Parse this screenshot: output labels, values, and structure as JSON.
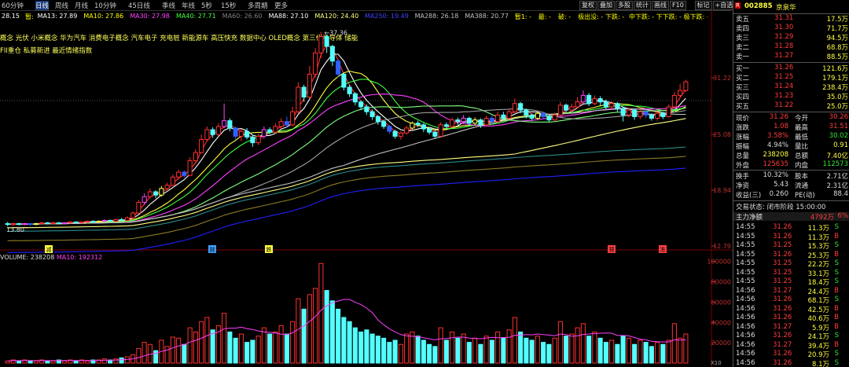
{
  "toolbar": {
    "periods": [
      "60分钟",
      "日线",
      "周线",
      "月线",
      "10分钟",
      "45日线",
      "季线",
      "年线",
      "5秒",
      "15秒",
      "多周期",
      "更多"
    ],
    "active": "日线",
    "right_buttons": [
      "复权",
      "叠加",
      "多股",
      "统计",
      "画线",
      "F10",
      "标记",
      "+自选",
      "返回"
    ]
  },
  "ma_legend": [
    {
      "text": "28.15",
      "color": "#ffffff"
    },
    {
      "text": "暂:",
      "color": "#ffff00"
    },
    {
      "text": "MA13: 27.89",
      "color": "#ffffff"
    },
    {
      "text": "MA10: 27.86",
      "color": "#ffff00"
    },
    {
      "text": "MA30: 27.98",
      "color": "#ff40ff"
    },
    {
      "text": "MA40: 27.71",
      "color": "#40ff40"
    },
    {
      "text": "MA60: 26.60",
      "color": "#808080"
    },
    {
      "text": "MA88: 27.10",
      "color": "#ffffff"
    },
    {
      "text": "MA120: 24.40",
      "color": "#ffff80"
    },
    {
      "text": "MA250: 19.49",
      "color": "#4040ff"
    },
    {
      "text": "MA288: 26.18",
      "color": "#c0c0c0"
    },
    {
      "text": "MA388: 20.77",
      "color": "#c0c0c0"
    },
    {
      "text": "暂1: -",
      "color": "#ffff00"
    },
    {
      "text": "最: -",
      "color": "#ffff00"
    },
    {
      "text": "破: -",
      "color": "#ffff00"
    },
    {
      "text": "极出没: -",
      "color": "#ffff00"
    },
    {
      "text": "下跌: -",
      "color": "#ffff00"
    },
    {
      "text": "中下跌: -",
      "color": "#ffff00"
    },
    {
      "text": "下下跌: -",
      "color": "#ffff00"
    },
    {
      "text": "极下跌: -",
      "color": "#ffff00"
    },
    {
      "text": "小冷窗: -",
      "color": "#ffff00"
    },
    {
      "text": "最高价跌幅%: 0.88",
      "color": "#40ff40"
    },
    {
      "text": "最低价120涨%: 0.8",
      "color": "#ff4040"
    }
  ],
  "concepts_line1": "概念 光伏 小米概念 华为汽车 消费电子概念 汽车电子 充电桩 新能源车 高压快充 数据中心 OLED概念 第三代半导体 储能",
  "concepts_line2": "FII重仓 私募新进 最近情绪指数",
  "price_axis": [
    "31.22",
    "25.08",
    "18.94",
    "12.79"
  ],
  "vol_axis": [
    "100000",
    "80000",
    "60000",
    "40000",
    "20000"
  ],
  "volume_label": {
    "vol": "VOLUME: 238208",
    "ma5": "MA10: 192312",
    "ma10": "MA10: 192312"
  },
  "peak_label": "37.36",
  "low_label": "13.80",
  "events": [
    {
      "t": "减",
      "c": "#ffff40"
    },
    {
      "t": "财",
      "c": "#40a0ff"
    },
    {
      "t": "跌",
      "c": "#ffff40"
    },
    {
      "t": "预",
      "c": "#ff4040"
    },
    {
      "t": "冻",
      "c": "#ff4040"
    }
  ],
  "x10": "X10",
  "quote": {
    "code": "002885",
    "name": "京泉华",
    "asks": [
      {
        "l": "卖五",
        "p": "31.31",
        "v": "17.5万"
      },
      {
        "l": "卖四",
        "p": "31.30",
        "v": "71.7万"
      },
      {
        "l": "卖三",
        "p": "31.29",
        "v": "94.5万"
      },
      {
        "l": "卖二",
        "p": "31.28",
        "v": "68.8万"
      },
      {
        "l": "卖一",
        "p": "31.27",
        "v": "88.5万"
      }
    ],
    "bids": [
      {
        "l": "买一",
        "p": "31.26",
        "v": "121.6万"
      },
      {
        "l": "买二",
        "p": "31.25",
        "v": "179.1万"
      },
      {
        "l": "买三",
        "p": "31.24",
        "v": "238.4万"
      },
      {
        "l": "买四",
        "p": "31.23",
        "v": "35.0万"
      },
      {
        "l": "买五",
        "p": "31.22",
        "v": "25.0万"
      }
    ],
    "stats": [
      {
        "a": "现价",
        "av": "31.26",
        "b": "今开",
        "bv": "30.26"
      },
      {
        "a": "涨跌",
        "av": "1.08",
        "b": "最高",
        "bv": "31.51"
      },
      {
        "a": "涨幅",
        "av": "3.58%",
        "b": "最低",
        "bv": "30.02"
      },
      {
        "a": "振幅",
        "av": "4.94%",
        "b": "量比",
        "bv": "0.91"
      },
      {
        "a": "总量",
        "av": "238208",
        "b": "总额",
        "bv": "7.40亿"
      },
      {
        "a": "外盘",
        "av": "125635",
        "b": "内盘",
        "bv": "112573"
      },
      {
        "a": "换手",
        "av": "10.32%",
        "b": "股本",
        "bv": "2.71亿"
      },
      {
        "a": "净资",
        "av": "5.43",
        "b": "流通",
        "bv": "2.31亿"
      },
      {
        "a": "收益(三)",
        "av": "0.260",
        "b": "PE(动)",
        "bv": "88.4"
      }
    ],
    "status": "交易状态: 闭市阶段 15:00:00",
    "net_inflow_label": "主力净额",
    "net_inflow": "4792万",
    "net_inflow_pct": "6%",
    "ticks": [
      {
        "t": "14:55",
        "p": "31.26",
        "v": "11.3万",
        "s": "S"
      },
      {
        "t": "14:55",
        "p": "31.26",
        "v": "11.3万",
        "s": "B"
      },
      {
        "t": "14:55",
        "p": "31.25",
        "v": "15.3万",
        "s": "S"
      },
      {
        "t": "14:55",
        "p": "31.26",
        "v": "25.3万",
        "s": "B"
      },
      {
        "t": "14:55",
        "p": "31.25",
        "v": "22.2万",
        "s": "S"
      },
      {
        "t": "14:55",
        "p": "31.25",
        "v": "33.1万",
        "s": "S"
      },
      {
        "t": "14:55",
        "p": "31.25",
        "v": "18.4万",
        "s": "S"
      },
      {
        "t": "14:56",
        "p": "31.27",
        "v": "24.4万",
        "s": "B"
      },
      {
        "t": "14:56",
        "p": "31.26",
        "v": "68.1万",
        "s": "S"
      },
      {
        "t": "14:56",
        "p": "31.26",
        "v": "42.5万",
        "s": "B"
      },
      {
        "t": "14:56",
        "p": "31.26",
        "v": "40.6万",
        "s": "B"
      },
      {
        "t": "14:56",
        "p": "31.27",
        "v": "5.9万",
        "s": "B"
      },
      {
        "t": "14:56",
        "p": "31.26",
        "v": "24.1万",
        "s": "S"
      },
      {
        "t": "14:56",
        "p": "31.27",
        "v": "39.4万",
        "s": "B"
      },
      {
        "t": "14:56",
        "p": "31.26",
        "v": "20.9万",
        "s": "S"
      },
      {
        "t": "14:56",
        "p": "31.26",
        "v": "8.1万",
        "s": "S"
      },
      {
        "t": "14:57",
        "p": "31.27",
        "v": "55.3万",
        "s": "B"
      }
    ]
  },
  "chart_data": {
    "type": "candlestick",
    "candles": [
      [
        13.9,
        13.8,
        14.1,
        13.6
      ],
      [
        13.8,
        13.9,
        14.0,
        13.6
      ],
      [
        13.9,
        13.8,
        14.0,
        13.7
      ],
      [
        13.8,
        13.9,
        14.0,
        13.7
      ],
      [
        13.9,
        13.8,
        14.0,
        13.6
      ],
      [
        13.8,
        13.9,
        14.0,
        13.7
      ],
      [
        13.9,
        14.0,
        14.1,
        13.8
      ],
      [
        14.0,
        13.9,
        14.1,
        13.8
      ],
      [
        13.9,
        14.0,
        14.1,
        13.8
      ],
      [
        14.0,
        13.9,
        14.1,
        13.8
      ],
      [
        13.9,
        14.0,
        14.1,
        13.8
      ],
      [
        14.0,
        14.1,
        14.2,
        13.9
      ],
      [
        14.1,
        14.0,
        14.2,
        13.9
      ],
      [
        14.0,
        14.1,
        14.2,
        13.9
      ],
      [
        14.1,
        14.2,
        14.3,
        14.0
      ],
      [
        14.2,
        14.1,
        14.3,
        14.0
      ],
      [
        14.1,
        14.2,
        14.3,
        14.0
      ],
      [
        14.2,
        14.3,
        14.4,
        14.1
      ],
      [
        14.3,
        14.2,
        14.4,
        14.1
      ],
      [
        14.2,
        14.4,
        14.5,
        14.1
      ],
      [
        14.4,
        14.3,
        14.6,
        14.2
      ],
      [
        14.3,
        14.6,
        14.8,
        14.2
      ],
      [
        14.6,
        15.2,
        15.4,
        14.5
      ],
      [
        15.2,
        16.5,
        16.8,
        15.1
      ],
      [
        16.5,
        17.2,
        17.6,
        16.2
      ],
      [
        17.2,
        17.8,
        18.2,
        17.0
      ],
      [
        17.8,
        17.4,
        18.0,
        17.0
      ],
      [
        17.4,
        18.2,
        18.5,
        17.2
      ],
      [
        18.2,
        18.6,
        18.9,
        18.0
      ],
      [
        18.6,
        19.6,
        19.9,
        18.5
      ],
      [
        19.6,
        20.2,
        20.5,
        19.3
      ],
      [
        20.2,
        19.8,
        20.4,
        19.5
      ],
      [
        19.8,
        21.6,
        22.0,
        19.7
      ],
      [
        21.6,
        22.6,
        23.0,
        21.4
      ],
      [
        22.6,
        24.2,
        24.8,
        22.5
      ],
      [
        24.2,
        25.4,
        25.8,
        24.0
      ],
      [
        25.4,
        24.8,
        25.7,
        24.4
      ],
      [
        24.8,
        25.8,
        26.2,
        24.6
      ],
      [
        25.8,
        26.5,
        28.6,
        25.6
      ],
      [
        26.5,
        25.6,
        26.8,
        25.2
      ],
      [
        25.6,
        24.6,
        25.8,
        24.2
      ],
      [
        24.6,
        25.2,
        25.5,
        24.0
      ],
      [
        25.2,
        24.5,
        25.6,
        24.2
      ],
      [
        24.5,
        23.8,
        24.8,
        23.3
      ],
      [
        23.8,
        24.6,
        24.9,
        23.5
      ],
      [
        24.6,
        25.4,
        25.8,
        24.3
      ],
      [
        25.4,
        25.1,
        25.7,
        24.8
      ],
      [
        25.1,
        25.8,
        26.2,
        24.9
      ],
      [
        25.8,
        26.4,
        26.8,
        25.5
      ],
      [
        26.4,
        26.0,
        27.0,
        25.6
      ],
      [
        26.0,
        27.6,
        28.2,
        25.8
      ],
      [
        27.6,
        30.6,
        31.2,
        27.4
      ],
      [
        30.6,
        29.4,
        30.9,
        28.8
      ],
      [
        29.4,
        32.2,
        33.2,
        29.2
      ],
      [
        32.2,
        34.8,
        35.4,
        31.8
      ],
      [
        34.8,
        36.8,
        37.36,
        34.2
      ],
      [
        36.8,
        35.6,
        37.0,
        34.8
      ],
      [
        35.6,
        33.8,
        35.8,
        33.2
      ],
      [
        33.8,
        32.2,
        34.0,
        31.8
      ],
      [
        32.2,
        30.6,
        32.4,
        30.2
      ],
      [
        30.6,
        29.8,
        30.9,
        29.4
      ],
      [
        29.8,
        28.8,
        30.0,
        28.4
      ],
      [
        28.8,
        28.2,
        29.0,
        27.8
      ],
      [
        28.2,
        27.6,
        28.5,
        27.2
      ],
      [
        27.6,
        27.0,
        27.9,
        26.6
      ],
      [
        27.0,
        26.4,
        27.2,
        26.0
      ],
      [
        26.4,
        25.8,
        26.6,
        25.5
      ],
      [
        25.8,
        25.2,
        26.0,
        24.9
      ],
      [
        25.2,
        24.6,
        25.4,
        24.3
      ],
      [
        24.6,
        25.0,
        25.2,
        24.2
      ],
      [
        25.0,
        25.6,
        25.9,
        24.8
      ],
      [
        25.6,
        26.2,
        26.4,
        25.4
      ],
      [
        26.2,
        26.0,
        26.5,
        25.7
      ],
      [
        26.0,
        25.5,
        26.2,
        25.1
      ],
      [
        25.5,
        25.1,
        25.7,
        24.8
      ],
      [
        25.1,
        24.6,
        25.3,
        24.3
      ],
      [
        24.6,
        26.0,
        26.3,
        24.5
      ],
      [
        26.0,
        25.8,
        26.3,
        25.5
      ],
      [
        25.8,
        26.6,
        26.9,
        25.6
      ],
      [
        26.6,
        26.4,
        26.9,
        26.0
      ],
      [
        26.4,
        26.8,
        27.2,
        26.1
      ],
      [
        26.8,
        26.2,
        27.0,
        25.9
      ],
      [
        26.2,
        26.6,
        26.9,
        25.9
      ],
      [
        26.6,
        26.0,
        26.8,
        25.6
      ],
      [
        26.0,
        26.8,
        27.1,
        25.8
      ],
      [
        26.8,
        26.4,
        27.1,
        26.0
      ],
      [
        26.4,
        27.2,
        27.6,
        26.2
      ],
      [
        27.2,
        26.8,
        27.6,
        26.5
      ],
      [
        26.8,
        27.6,
        28.0,
        26.6
      ],
      [
        27.6,
        28.6,
        29.2,
        27.4
      ],
      [
        28.6,
        27.8,
        28.8,
        27.4
      ],
      [
        27.8,
        27.2,
        28.0,
        26.8
      ],
      [
        27.2,
        26.8,
        27.4,
        26.5
      ],
      [
        26.8,
        27.4,
        27.6,
        26.6
      ],
      [
        27.4,
        27.0,
        27.6,
        26.7
      ],
      [
        27.0,
        26.6,
        27.2,
        26.3
      ],
      [
        26.6,
        27.2,
        27.5,
        26.4
      ],
      [
        27.2,
        28.4,
        28.8,
        27.0
      ],
      [
        28.4,
        27.8,
        28.6,
        27.5
      ],
      [
        27.8,
        28.2,
        28.6,
        27.5
      ],
      [
        28.2,
        28.8,
        29.4,
        28.0
      ],
      [
        28.8,
        29.6,
        30.2,
        28.6
      ],
      [
        29.6,
        28.6,
        29.9,
        28.3
      ],
      [
        28.6,
        29.2,
        29.6,
        28.4
      ],
      [
        29.2,
        28.8,
        29.5,
        28.4
      ],
      [
        28.8,
        28.2,
        29.1,
        27.9
      ],
      [
        28.2,
        28.6,
        28.9,
        27.8
      ],
      [
        28.6,
        28.0,
        28.8,
        27.6
      ],
      [
        28.0,
        27.2,
        28.2,
        26.4
      ],
      [
        27.2,
        27.8,
        28.1,
        26.9
      ],
      [
        27.8,
        27.0,
        28.0,
        26.6
      ],
      [
        27.0,
        27.6,
        27.9,
        26.7
      ],
      [
        27.6,
        27.2,
        27.9,
        26.8
      ],
      [
        27.2,
        26.8,
        27.4,
        26.5
      ],
      [
        26.8,
        27.4,
        27.7,
        26.5
      ],
      [
        27.4,
        27.0,
        27.6,
        26.7
      ],
      [
        27.0,
        28.2,
        28.5,
        26.9
      ],
      [
        28.2,
        29.6,
        30.0,
        28.0
      ],
      [
        29.6,
        30.2,
        31.0,
        29.4
      ],
      [
        30.2,
        31.26,
        31.51,
        30.02
      ]
    ],
    "volumes": [
      2,
      3,
      2,
      3,
      2,
      2,
      3,
      2,
      2,
      3,
      2,
      3,
      2,
      3,
      2,
      3,
      3,
      4,
      3,
      4,
      5,
      6,
      8,
      14,
      20,
      18,
      12,
      22,
      16,
      25,
      24,
      18,
      34,
      30,
      40,
      44,
      32,
      36,
      48,
      30,
      24,
      28,
      20,
      22,
      26,
      34,
      28,
      30,
      36,
      28,
      40,
      62,
      52,
      66,
      72,
      96,
      70,
      60,
      52,
      44,
      40,
      34,
      30,
      32,
      28,
      26,
      24,
      20,
      22,
      18,
      28,
      30,
      26,
      22,
      18,
      16,
      34,
      22,
      30,
      24,
      28,
      20,
      24,
      18,
      26,
      22,
      30,
      24,
      32,
      44,
      30,
      24,
      22,
      26,
      20,
      18,
      24,
      40,
      26,
      28,
      34,
      38,
      26,
      30,
      24,
      20,
      22,
      18,
      26,
      24,
      18,
      22,
      20,
      16,
      20,
      18,
      22,
      38,
      24,
      28
    ],
    "vol_unit": "手(×1000)"
  }
}
